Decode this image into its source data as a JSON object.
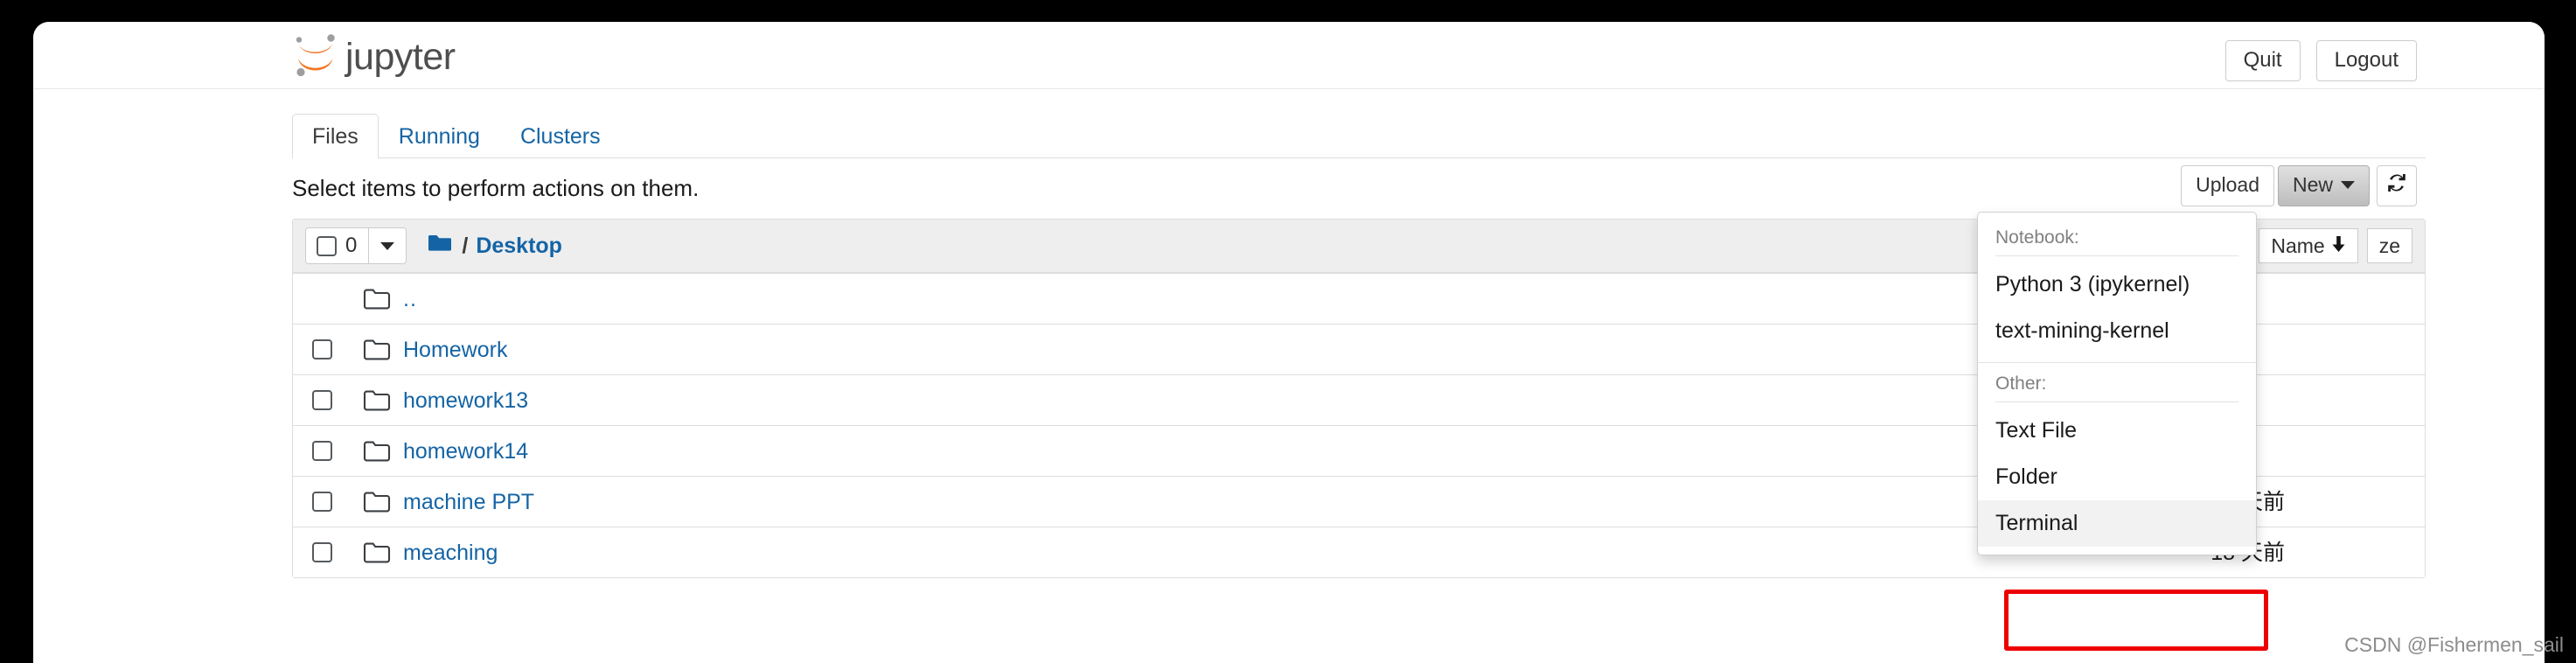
{
  "header": {
    "logo_text": "jupyter",
    "logo_icon": "jupyter-logo-icon",
    "quit_label": "Quit",
    "logout_label": "Logout"
  },
  "tabs": [
    {
      "label": "Files",
      "active": true
    },
    {
      "label": "Running",
      "active": false
    },
    {
      "label": "Clusters",
      "active": false
    }
  ],
  "notice": "Select items to perform actions on them.",
  "actions": {
    "upload_label": "Upload",
    "new_label": "New",
    "new_caret_icon": "caret-down-icon",
    "refresh_icon": "refresh-icon"
  },
  "filelist": {
    "selection_count": "0",
    "select_all_caret_icon": "caret-down-icon",
    "breadcrumb": {
      "home_icon": "folder-home-icon",
      "separator": "/",
      "current": "Desktop"
    },
    "sort": {
      "name_label": "Name",
      "name_sort_icon": "arrow-down-icon",
      "size_label": "ze"
    },
    "rows": [
      {
        "name": "..",
        "icon": "folder-icon",
        "has_checkbox": false,
        "time": ""
      },
      {
        "name": "Homework",
        "icon": "folder-icon",
        "has_checkbox": true,
        "time": ""
      },
      {
        "name": "homework13",
        "icon": "folder-icon",
        "has_checkbox": true,
        "time": ""
      },
      {
        "name": "homework14",
        "icon": "folder-icon",
        "has_checkbox": true,
        "time": ""
      },
      {
        "name": "machine PPT",
        "icon": "folder-icon",
        "has_checkbox": true,
        "time": "2 天前"
      },
      {
        "name": "meaching",
        "icon": "folder-icon",
        "has_checkbox": true,
        "time": "18 天前"
      }
    ]
  },
  "new_menu": {
    "notebook_header": "Notebook:",
    "notebook_items": [
      {
        "label": "Python 3 (ipykernel)",
        "hovered": false
      },
      {
        "label": "text-mining-kernel",
        "hovered": false
      }
    ],
    "other_header": "Other:",
    "other_items": [
      {
        "label": "Text File",
        "hovered": false
      },
      {
        "label": "Folder",
        "hovered": false
      },
      {
        "label": "Terminal",
        "hovered": true
      }
    ]
  },
  "annotation": {
    "target": "Terminal",
    "color": "#ee0000"
  },
  "watermark": "CSDN @Fishermen_sail",
  "colors": {
    "link_blue": "#1464a5",
    "logo_orange": "#f37726",
    "toolbar_gray": "#eeeeee",
    "border_gray": "#dddddd",
    "annotation_red": "#ee0000"
  }
}
